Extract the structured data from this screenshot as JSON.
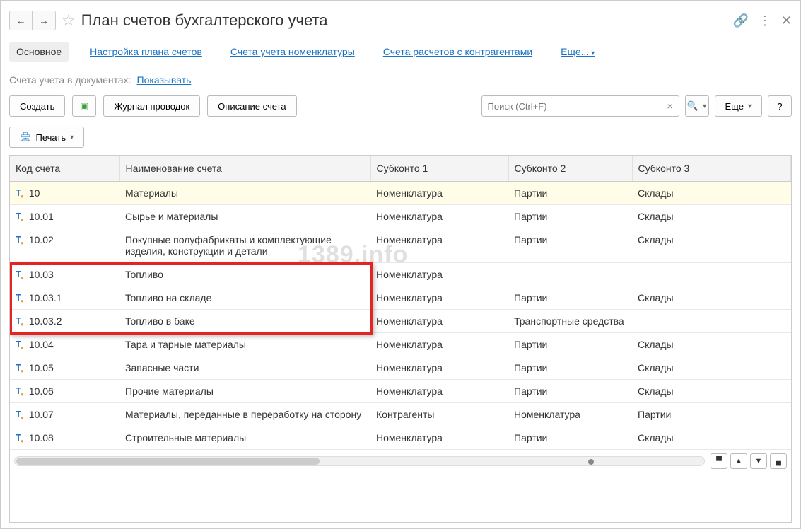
{
  "header": {
    "title": "План счетов бухгалтерского учета"
  },
  "tabs": {
    "main": "Основное",
    "settings": "Настройка плана счетов",
    "accounts_nom": "Счета учета номенклатуры",
    "accounts_contr": "Счета расчетов с контрагентами",
    "more": "Еще..."
  },
  "sub": {
    "label": "Счета учета в документах:",
    "link": "Показывать"
  },
  "toolbar": {
    "create": "Создать",
    "journal": "Журнал проводок",
    "descr": "Описание счета",
    "search_placeholder": "Поиск (Ctrl+F)",
    "more": "Еще",
    "help": "?",
    "print": "Печать"
  },
  "columns": {
    "code": "Код счета",
    "name": "Наименование счета",
    "s1": "Субконто 1",
    "s2": "Субконто 2",
    "s3": "Субконто 3"
  },
  "rows": [
    {
      "code": "10",
      "name": "Материалы",
      "s1": "Номенклатура",
      "s2": "Партии",
      "s3": "Склады",
      "hl": true
    },
    {
      "code": "10.01",
      "name": "Сырье и материалы",
      "s1": "Номенклатура",
      "s2": "Партии",
      "s3": "Склады"
    },
    {
      "code": "10.02",
      "name": "Покупные полуфабрикаты и комплектующие изделия, конструкции и детали",
      "s1": "Номенклатура",
      "s2": "Партии",
      "s3": "Склады"
    },
    {
      "code": "10.03",
      "name": "Топливо",
      "s1": "Номенклатура",
      "s2": "",
      "s3": "",
      "box": true
    },
    {
      "code": "10.03.1",
      "name": "Топливо на складе",
      "s1": "Номенклатура",
      "s2": "Партии",
      "s3": "Склады",
      "box": true
    },
    {
      "code": "10.03.2",
      "name": "Топливо в баке",
      "s1": "Номенклатура",
      "s2": "Транспортные средства",
      "s3": "",
      "box": true
    },
    {
      "code": "10.04",
      "name": "Тара и тарные материалы",
      "s1": "Номенклатура",
      "s2": "Партии",
      "s3": "Склады"
    },
    {
      "code": "10.05",
      "name": "Запасные части",
      "s1": "Номенклатура",
      "s2": "Партии",
      "s3": "Склады"
    },
    {
      "code": "10.06",
      "name": "Прочие материалы",
      "s1": "Номенклатура",
      "s2": "Партии",
      "s3": "Склады"
    },
    {
      "code": "10.07",
      "name": "Материалы, переданные в переработку на сторону",
      "s1": "Контрагенты",
      "s2": "Номенклатура",
      "s3": "Партии"
    },
    {
      "code": "10.08",
      "name": "Строительные материалы",
      "s1": "Номенклатура",
      "s2": "Партии",
      "s3": "Склады"
    }
  ],
  "watermark": "1389.info"
}
